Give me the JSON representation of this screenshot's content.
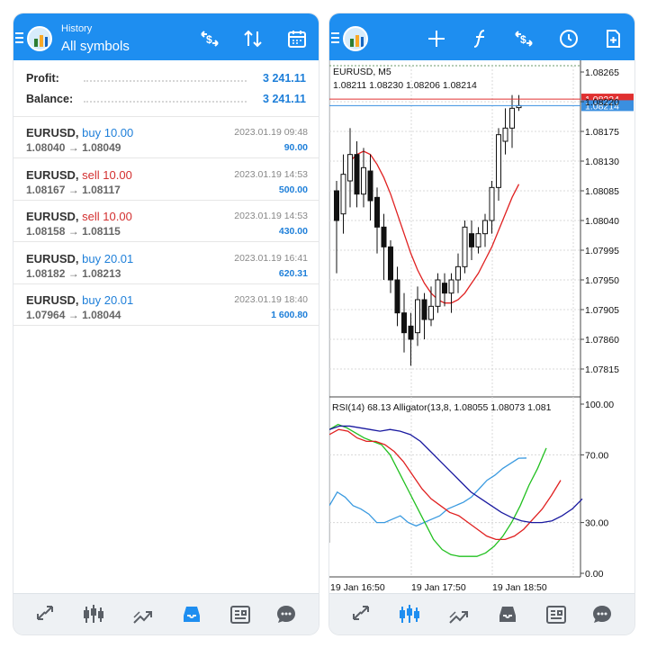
{
  "left_panel": {
    "subtitle": "History",
    "title": "All symbols",
    "summary": [
      {
        "label": "Profit:",
        "value": "3 241.11"
      },
      {
        "label": "Balance:",
        "value": "3 241.11"
      }
    ],
    "deals": [
      {
        "symbol": "EURUSD,",
        "direction": "buy",
        "volume": "10.00",
        "open": "1.08040",
        "arrow": "→",
        "close": "1.08049",
        "date": "2023.01.19 09:48",
        "profit": "90.00"
      },
      {
        "symbol": "EURUSD,",
        "direction": "sell",
        "volume": "10.00",
        "open": "1.08167",
        "arrow": "→",
        "close": "1.08117",
        "date": "2023.01.19 14:53",
        "profit": "500.00"
      },
      {
        "symbol": "EURUSD,",
        "direction": "sell",
        "volume": "10.00",
        "open": "1.08158",
        "arrow": "→",
        "close": "1.08115",
        "date": "2023.01.19 14:53",
        "profit": "430.00"
      },
      {
        "symbol": "EURUSD,",
        "direction": "buy",
        "volume": "20.01",
        "open": "1.08182",
        "arrow": "→",
        "close": "1.08213",
        "date": "2023.01.19 16:41",
        "profit": "620.31"
      },
      {
        "symbol": "EURUSD,",
        "direction": "buy",
        "volume": "20.01",
        "open": "1.07964",
        "arrow": "→",
        "close": "1.08044",
        "date": "2023.01.19 18:40",
        "profit": "1 600.80"
      }
    ],
    "toolbar_icons": [
      "currency-exchange-icon",
      "sort-icon",
      "calendar-icon"
    ],
    "nav_icons": [
      "quotes-icon",
      "chart-icon",
      "trade-icon",
      "history-icon",
      "news-icon",
      "messages-icon"
    ],
    "active_nav": 3
  },
  "right_panel": {
    "toolbar_icons": [
      "crosshair-icon",
      "indicators-icon",
      "currency-exchange-icon",
      "timeframe-icon",
      "new-order-icon"
    ],
    "nav_icons": [
      "quotes-icon",
      "chart-icon",
      "trade-icon",
      "history-icon",
      "news-icon",
      "messages-icon"
    ],
    "active_nav": 1,
    "chart_info": {
      "symbol_line": "EURUSD, M5",
      "ohlc_line": "1.08211 1.08230 1.08206 1.08214",
      "indicator_line": "RSI(14) 68.13 Alligator(13,8, 1.08055 1.08073 1.081"
    },
    "price_badges": [
      {
        "value": "1.08224",
        "color": "#e03030"
      },
      {
        "value": "1.08214",
        "color": "#3a8fe0"
      }
    ],
    "colors": {
      "accent": "#1e8ef0",
      "buy": "#1e7fd9",
      "sell": "#d32f2f",
      "ma": "#e02020",
      "rsi": "#3a9ae0",
      "alligator_jaw": "#1a1aa0",
      "alligator_teeth": "#e02020",
      "alligator_lips": "#22c020"
    }
  },
  "chart_data": [
    {
      "type": "candlestick",
      "title": "EURUSD, M5",
      "y_ticks": [
        "1.08265",
        "1.08220",
        "1.08175",
        "1.08130",
        "1.08085",
        "1.08040",
        "1.07995",
        "1.07950",
        "1.07905",
        "1.07860",
        "1.07815"
      ],
      "ylim": [
        1.0778,
        1.0828
      ],
      "x_ticks": [
        "19 Jan 16:50",
        "19 Jan 17:50",
        "19 Jan 18:50"
      ],
      "candles": [
        [
          1.08085,
          1.081,
          1.0796,
          1.0804
        ],
        [
          1.0805,
          1.0814,
          1.0802,
          1.0811
        ],
        [
          1.081,
          1.0818,
          1.0806,
          1.0814
        ],
        [
          1.0814,
          1.0816,
          1.0806,
          1.0808
        ],
        [
          1.0808,
          1.0815,
          1.0806,
          1.0812
        ],
        [
          1.08115,
          1.0814,
          1.0804,
          1.0807
        ],
        [
          1.08075,
          1.0809,
          1.0799,
          1.0803
        ],
        [
          1.0803,
          1.0805,
          1.0795,
          1.08
        ],
        [
          1.08,
          1.0801,
          1.0793,
          1.0795
        ],
        [
          1.0795,
          1.0797,
          1.0788,
          1.079
        ],
        [
          1.079,
          1.0793,
          1.0784,
          1.0787
        ],
        [
          1.0788,
          1.079,
          1.0782,
          1.0786
        ],
        [
          1.0787,
          1.0794,
          1.0785,
          1.0792
        ],
        [
          1.0792,
          1.0793,
          1.0786,
          1.0789
        ],
        [
          1.0789,
          1.0794,
          1.0788,
          1.0791
        ],
        [
          1.0791,
          1.0796,
          1.079,
          1.0795
        ],
        [
          1.07945,
          1.0796,
          1.0791,
          1.0793
        ],
        [
          1.0793,
          1.0796,
          1.079,
          1.0795
        ],
        [
          1.0795,
          1.0799,
          1.0793,
          1.0797
        ],
        [
          1.0797,
          1.0804,
          1.0796,
          1.0803
        ],
        [
          1.0802,
          1.0804,
          1.0798,
          1.08
        ],
        [
          1.08,
          1.0803,
          1.0799,
          1.0802
        ],
        [
          1.0802,
          1.0805,
          1.08,
          1.0804
        ],
        [
          1.0804,
          1.081,
          1.0802,
          1.0809
        ],
        [
          1.0809,
          1.0818,
          1.0807,
          1.0817
        ],
        [
          1.0816,
          1.0821,
          1.0814,
          1.0818
        ],
        [
          1.0818,
          1.0823,
          1.0815,
          1.0821
        ],
        [
          1.08211,
          1.0823,
          1.08206,
          1.08214
        ]
      ],
      "ma_series": [
        1.0813,
        1.0814,
        1.08145,
        1.0814,
        1.08125,
        1.08105,
        1.0808,
        1.0805,
        1.0802,
        1.0799,
        1.07965,
        1.07945,
        1.0793,
        1.0792,
        1.07915,
        1.07915,
        1.0792,
        1.0793,
        1.07945,
        1.0796,
        1.0798,
        1.08,
        1.08025,
        1.0805,
        1.08075,
        1.08095
      ]
    },
    {
      "type": "line",
      "title": "RSI(14) 68.13 Alligator(13,8, 1.08055 1.08073 1.081",
      "y_ticks": [
        "100.00",
        "70.00",
        "30.00",
        "0.00"
      ],
      "ylim": [
        0,
        100
      ],
      "series": [
        {
          "name": "RSI(14)",
          "values": [
            40,
            48,
            45,
            40,
            38,
            35,
            30,
            30,
            32,
            34,
            30,
            28,
            30,
            32,
            34,
            38,
            40,
            42,
            45,
            50,
            55,
            58,
            62,
            65,
            68,
            68.13
          ]
        },
        {
          "name": "Alligator",
          "values": [
            85,
            88,
            86,
            83,
            80,
            78,
            76,
            70,
            60,
            50,
            40,
            30,
            20,
            14,
            11,
            10,
            10,
            10,
            12,
            16,
            22,
            30,
            40,
            52,
            62,
            74
          ]
        },
        {
          "name": "",
          "values": [
            82,
            85,
            84,
            80,
            78,
            78,
            76,
            72,
            66,
            58,
            50,
            44,
            40,
            36,
            34,
            30,
            26,
            22,
            20,
            20,
            22,
            26,
            32,
            38,
            46,
            55
          ]
        },
        {
          "name": "",
          "values": [
            85,
            87,
            87,
            86,
            85,
            84,
            85,
            84,
            82,
            78,
            72,
            66,
            60,
            54,
            48,
            44,
            40,
            36,
            33,
            31,
            30,
            30,
            31,
            34,
            38,
            44
          ]
        }
      ]
    }
  ]
}
